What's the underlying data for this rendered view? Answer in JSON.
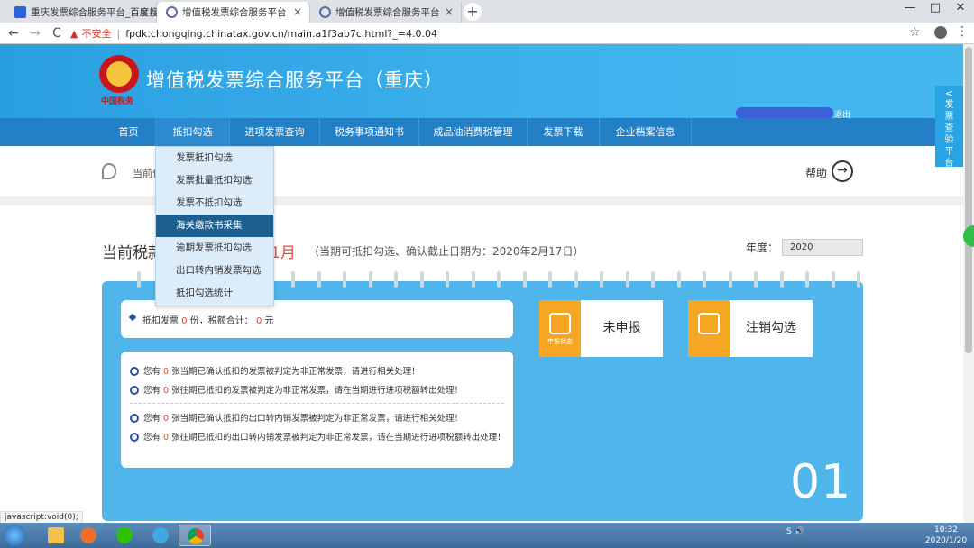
{
  "browser": {
    "tabs": [
      {
        "title": "重庆发票综合服务平台_百度搜索",
        "icon": "baidu-paw-icon",
        "active": false
      },
      {
        "title": "增值税发票综合服务平台",
        "icon": "globe-icon",
        "active": true
      },
      {
        "title": "增值税发票综合服务平台",
        "icon": "globe-icon",
        "active": false
      }
    ],
    "new_tab": "+",
    "tab_close": "×",
    "insecure_label": "不安全",
    "url": "fpdk.chongqing.chinatax.gov.cn/main.a1f3ab7c.html?_=4.0.04",
    "back": "←",
    "forward": "→",
    "reload": "C",
    "star": "☆",
    "menu": "⋮",
    "min": "—",
    "max": "□",
    "close": "✕",
    "status_hint": "javascript:void(0);"
  },
  "header": {
    "site_title": "增值税发票综合服务平台（重庆）",
    "emblem_text": "中国税务",
    "exit_label": "退出"
  },
  "nav": {
    "items": [
      "首页",
      "抵扣勾选",
      "进项发票查询",
      "税务事项通知书",
      "成品油消费税管理",
      "发票下载",
      "企业档案信息"
    ]
  },
  "dropdown": {
    "items": [
      "发票抵扣勾选",
      "发票批量抵扣勾选",
      "发票不抵扣勾选",
      "海关缴款书采集",
      "逾期发票抵扣勾选",
      "出口转内销发票勾选",
      "抵扣勾选统计"
    ],
    "highlighted_index": 3
  },
  "breadcrumb": {
    "label": "当前位",
    "help_label": "帮助",
    "help_icon": "→"
  },
  "period": {
    "label": "当前税款",
    "month": "1月",
    "note": "（当期可抵扣勾选、确认截止日期为：2020年2月17日）",
    "year_label": "年度：",
    "year_value": "2020"
  },
  "summary": {
    "prefix": "抵扣发票",
    "count": "0",
    "mid": "份，税额合计：",
    "amount": "0",
    "suffix": "元"
  },
  "notices": [
    {
      "prefix": "您有",
      "count": "0",
      "text": "张当期已确认抵扣的发票被判定为非正常发票，请进行相关处理！"
    },
    {
      "prefix": "您有",
      "count": "0",
      "text": "张往期已抵扣的发票被判定为非正常发票，请在当期进行进项税额转出处理！"
    },
    {
      "prefix": "您有",
      "count": "0",
      "text": "张当期已确认抵扣的出口转内销发票被判定为非正常发票，请进行相关处理！"
    },
    {
      "prefix": "您有",
      "count": "0",
      "text": "张往期已抵扣的出口转内销发票被判定为非正常发票，请在当期进行进项税额转出处理！"
    }
  ],
  "tiles": {
    "declare": {
      "icon_caption": "申报状态",
      "label": "未申报"
    },
    "cancel": {
      "label": "注销勾选"
    }
  },
  "calendar_day": "01",
  "side_float": {
    "arrow": "<",
    "text": "发票查验平台"
  },
  "taskbar": {
    "time": "10:32",
    "date": "2020/1/20",
    "tray_text": "S 🔊"
  },
  "colors": {
    "header_blue": "#3fb2ee",
    "nav_blue": "#2380c7",
    "accent_red": "#e04a3a",
    "calendar_blue": "#4fb5ea",
    "tile_orange": "#f5a623",
    "dropdown_highlight": "#1d5f8f"
  }
}
